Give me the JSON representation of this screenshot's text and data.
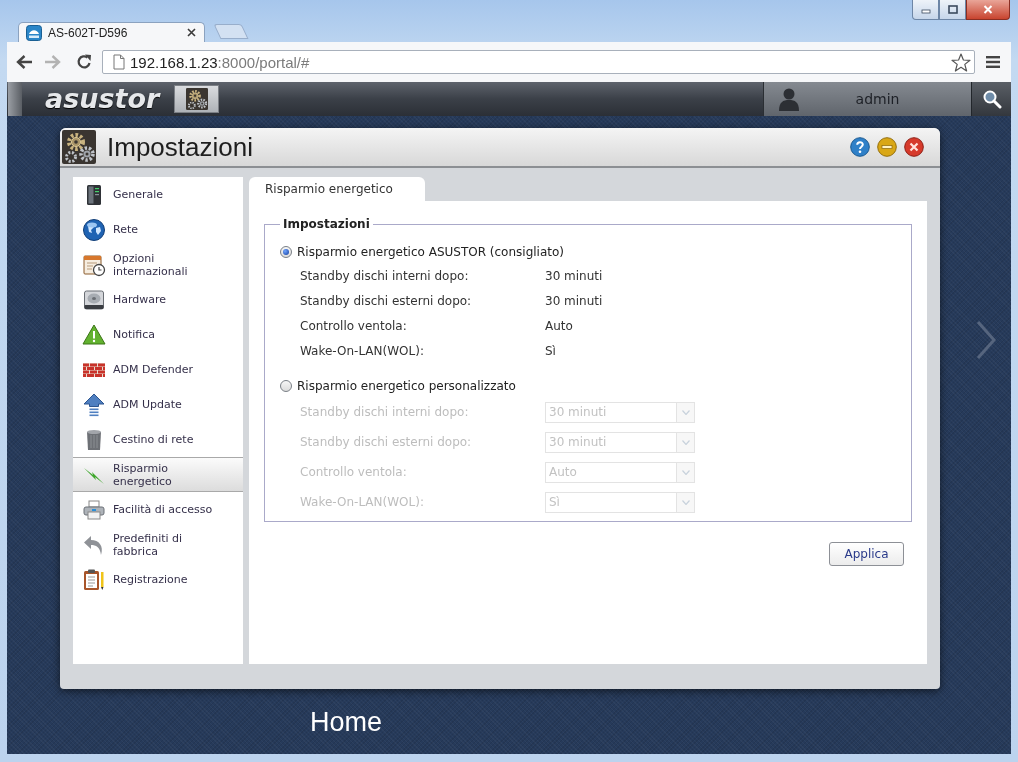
{
  "browser": {
    "tabs": [
      {
        "title": "AS-602T-D596",
        "selected": true
      }
    ],
    "address": {
      "host": "192.168.1.23",
      "path": ":8000/portal/#"
    }
  },
  "top_bar": {
    "logo": "asustor",
    "user": "admin"
  },
  "settings_window": {
    "title": "Impostazioni",
    "sidebar": {
      "items": [
        {
          "label": "Generale",
          "selected": false
        },
        {
          "label": "Rete",
          "selected": false
        },
        {
          "label": "Opzioni internazionali",
          "selected": false
        },
        {
          "label": "Hardware",
          "selected": false
        },
        {
          "label": "Notifica",
          "selected": false
        },
        {
          "label": "ADM Defender",
          "selected": false
        },
        {
          "label": "ADM Update",
          "selected": false
        },
        {
          "label": "Cestino di rete",
          "selected": false
        },
        {
          "label": "Risparmio energetico",
          "selected": true
        },
        {
          "label": "Facilità di accesso",
          "selected": false
        },
        {
          "label": "Predefiniti di fabbrica",
          "selected": false
        },
        {
          "label": "Registrazione",
          "selected": false
        }
      ]
    },
    "tabs": [
      {
        "label": "Risparmio energetico",
        "selected": true
      }
    ],
    "group": {
      "legend": "Impostazioni",
      "options": [
        {
          "label": "Risparmio energetico ASUSTOR (consigliato)",
          "selected": true,
          "settings": [
            {
              "kind": "text",
              "label": "Standby dischi interni dopo:",
              "value": "30 minuti",
              "disabled": false
            },
            {
              "kind": "text",
              "label": "Standby dischi esterni dopo:",
              "value": "30 minuti",
              "disabled": false
            },
            {
              "kind": "text",
              "label": "Controllo ventola:",
              "value": "Auto",
              "disabled": false
            },
            {
              "kind": "text",
              "label": "Wake-On-LAN(WOL):",
              "value": "Sì",
              "disabled": false
            }
          ]
        },
        {
          "label": "Risparmio energetico personalizzato",
          "selected": false,
          "settings": [
            {
              "kind": "select",
              "label": "Standby dischi interni dopo:",
              "value": "30 minuti",
              "disabled": true
            },
            {
              "kind": "select",
              "label": "Standby dischi esterni dopo:",
              "value": "30 minuti",
              "disabled": true
            },
            {
              "kind": "select",
              "label": "Controllo ventola:",
              "value": "Auto",
              "disabled": true
            },
            {
              "kind": "select",
              "label": "Wake-On-LAN(WOL):",
              "value": "Sì",
              "disabled": true
            }
          ]
        }
      ]
    },
    "buttons": [
      "Applica"
    ]
  },
  "desktop": {
    "label": "Home"
  }
}
